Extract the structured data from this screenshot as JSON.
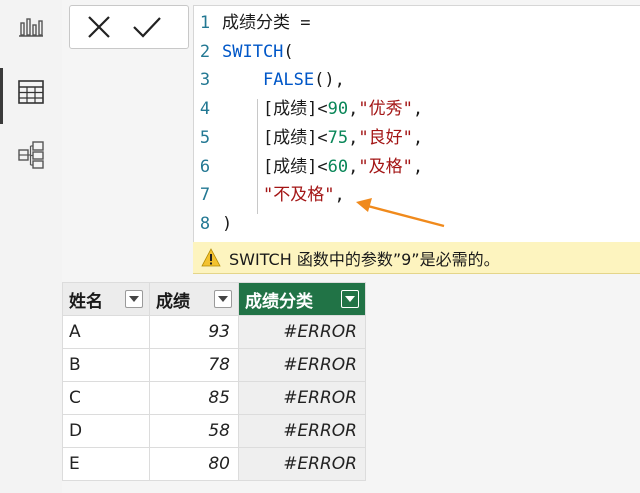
{
  "editor": {
    "lines": [
      {
        "no": "1",
        "tokens": [
          {
            "t": "成绩分类 =",
            "c": ""
          }
        ]
      },
      {
        "no": "2",
        "tokens": [
          {
            "t": "SWITCH",
            "c": "kw"
          },
          {
            "t": "(",
            "c": ""
          }
        ]
      },
      {
        "no": "3",
        "tokens": [
          {
            "t": "    ",
            "c": ""
          },
          {
            "t": "FALSE",
            "c": "kw"
          },
          {
            "t": "(),",
            "c": ""
          }
        ]
      },
      {
        "no": "4",
        "tokens": [
          {
            "t": "    [成绩]<",
            "c": ""
          },
          {
            "t": "90",
            "c": "num"
          },
          {
            "t": ",",
            "c": ""
          },
          {
            "t": "\"优秀\"",
            "c": "str"
          },
          {
            "t": ",",
            "c": ""
          }
        ]
      },
      {
        "no": "5",
        "tokens": [
          {
            "t": "    [成绩]<",
            "c": ""
          },
          {
            "t": "75",
            "c": "num"
          },
          {
            "t": ",",
            "c": ""
          },
          {
            "t": "\"良好\"",
            "c": "str"
          },
          {
            "t": ",",
            "c": ""
          }
        ]
      },
      {
        "no": "6",
        "tokens": [
          {
            "t": "    [成绩]<",
            "c": ""
          },
          {
            "t": "60",
            "c": "num"
          },
          {
            "t": ",",
            "c": ""
          },
          {
            "t": "\"及格\"",
            "c": "str"
          },
          {
            "t": ",",
            "c": ""
          }
        ]
      },
      {
        "no": "7",
        "tokens": [
          {
            "t": "    ",
            "c": ""
          },
          {
            "t": "\"不及格\"",
            "c": "str"
          },
          {
            "t": ",",
            "c": ""
          }
        ]
      },
      {
        "no": "8",
        "tokens": [
          {
            "t": ")",
            "c": ""
          }
        ]
      }
    ]
  },
  "error": {
    "message": "SWITCH 函数中的参数”9”是必需的。"
  },
  "table": {
    "headers": [
      "姓名",
      "成绩",
      "成绩分类"
    ],
    "rows": [
      {
        "name": "A",
        "score": "93",
        "category": "#ERROR"
      },
      {
        "name": "B",
        "score": "78",
        "category": "#ERROR"
      },
      {
        "name": "C",
        "score": "85",
        "category": "#ERROR"
      },
      {
        "name": "D",
        "score": "58",
        "category": "#ERROR"
      },
      {
        "name": "E",
        "score": "80",
        "category": "#ERROR"
      }
    ]
  },
  "colors": {
    "keyword": "#0057c8",
    "number": "#098658",
    "string": "#a31515",
    "highlight_header": "#217346",
    "arrow": "#f08a1c",
    "error_bar": "#fdf4bf"
  },
  "icons": {
    "rail": [
      "report-view-icon",
      "table-view-icon",
      "model-view-icon"
    ],
    "controls": [
      "cancel-x-icon",
      "commit-check-icon"
    ],
    "warning": "warning-icon"
  }
}
